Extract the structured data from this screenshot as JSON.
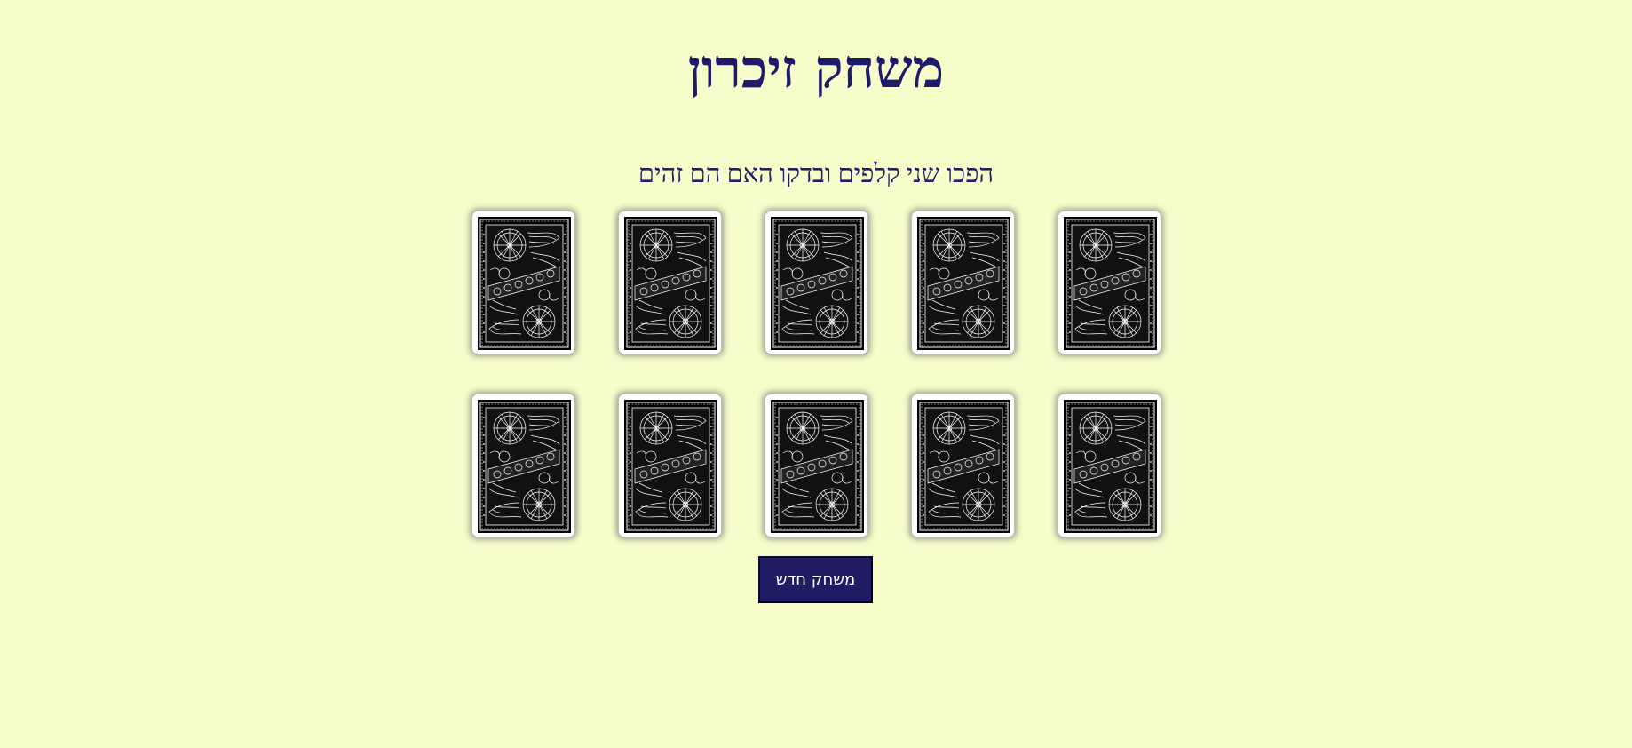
{
  "game": {
    "title": "משחק זיכרון",
    "instructions": "הפכו שני קלפים ובדקו האם הם זהים",
    "new_game_label": "משחק חדש"
  },
  "board": {
    "rows": 2,
    "columns": 5,
    "cards": [
      {
        "state": "face-down"
      },
      {
        "state": "face-down"
      },
      {
        "state": "face-down"
      },
      {
        "state": "face-down"
      },
      {
        "state": "face-down"
      },
      {
        "state": "face-down"
      },
      {
        "state": "face-down"
      },
      {
        "state": "face-down"
      },
      {
        "state": "face-down"
      },
      {
        "state": "face-down"
      }
    ]
  },
  "colors": {
    "background": "#f7fccb",
    "title": "#1f1a6a",
    "button": "#201c64",
    "card_back": "#000000"
  }
}
